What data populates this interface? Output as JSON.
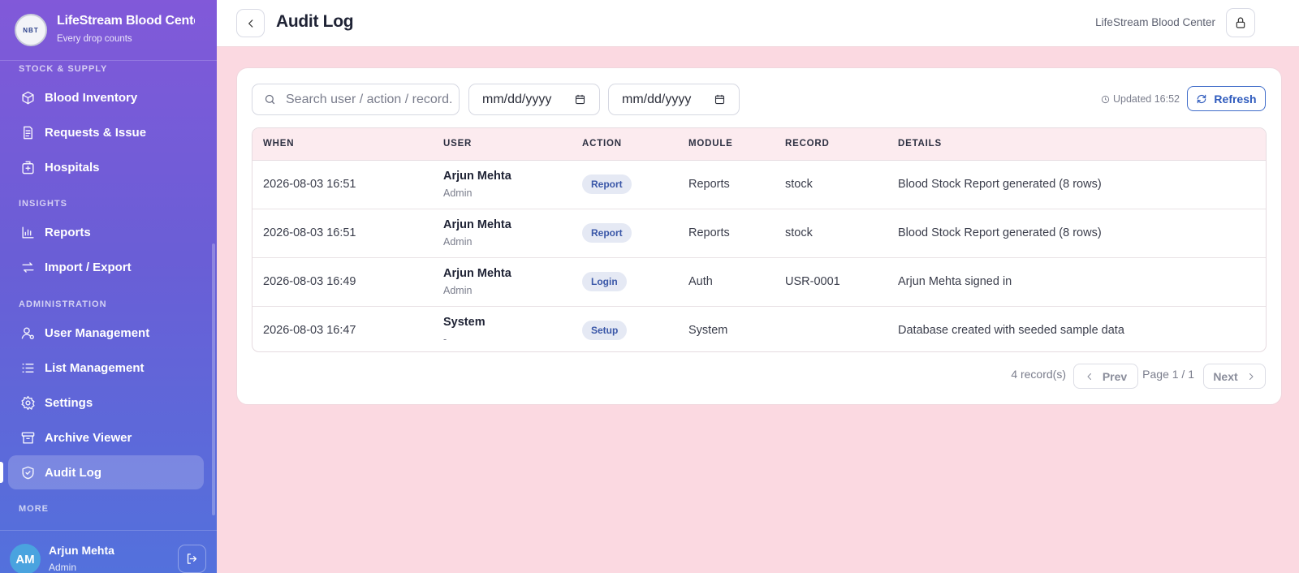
{
  "brand": {
    "logo_text": "NBT",
    "title": "LifeStream Blood Center",
    "subtitle": "Every drop counts"
  },
  "sidebar": {
    "sections": [
      {
        "label": "STOCK & SUPPLY"
      },
      {
        "label": "INSIGHTS"
      },
      {
        "label": "ADMINISTRATION"
      },
      {
        "label": "MORE"
      }
    ],
    "items": [
      {
        "label": "Blood Inventory",
        "icon": "box-icon"
      },
      {
        "label": "Requests & Issue",
        "icon": "document-icon"
      },
      {
        "label": "Hospitals",
        "icon": "hospital-icon"
      },
      {
        "label": "Reports",
        "icon": "bar-chart-icon"
      },
      {
        "label": "Import / Export",
        "icon": "transfer-icon"
      },
      {
        "label": "User Management",
        "icon": "user-cog-icon"
      },
      {
        "label": "List Management",
        "icon": "list-icon"
      },
      {
        "label": "Settings",
        "icon": "gear-icon"
      },
      {
        "label": "Archive Viewer",
        "icon": "archive-icon"
      },
      {
        "label": "Audit Log",
        "icon": "shield-check-icon",
        "active": true
      }
    ],
    "user": {
      "initials": "AM",
      "name": "Arjun Mehta",
      "role": "Admin"
    }
  },
  "header": {
    "title": "Audit Log",
    "org_name": "LifeStream Blood Center"
  },
  "filters": {
    "search_placeholder": "Search user / action / record...",
    "date_from": "mm/dd/yyyy",
    "date_to": "mm/dd/yyyy",
    "updated": "Updated 16:52",
    "refresh_label": "Refresh"
  },
  "table": {
    "columns": [
      "WHEN",
      "USER",
      "ACTION",
      "MODULE",
      "RECORD",
      "DETAILS"
    ],
    "rows": [
      {
        "when": "2026-08-03 16:51",
        "user": "Arjun Mehta",
        "role": "Admin",
        "action": "Report",
        "module": "Reports",
        "record": "stock",
        "details": "Blood Stock Report generated (8 rows)"
      },
      {
        "when": "2026-08-03 16:51",
        "user": "Arjun Mehta",
        "role": "Admin",
        "action": "Report",
        "module": "Reports",
        "record": "stock",
        "details": "Blood Stock Report generated (8 rows)"
      },
      {
        "when": "2026-08-03 16:49",
        "user": "Arjun Mehta",
        "role": "Admin",
        "action": "Login",
        "module": "Auth",
        "record": "USR-0001",
        "details": "Arjun Mehta signed in"
      },
      {
        "when": "2026-08-03 16:47",
        "user": "System",
        "role": "-",
        "action": "Setup",
        "module": "System",
        "record": "",
        "details": "Database created with seeded sample data"
      }
    ]
  },
  "pagination": {
    "count": "4 record(s)",
    "prev_label": "Prev",
    "page_info": "Page 1 / 1",
    "next_label": "Next"
  },
  "colors": {
    "sidebar_top": "#8159d9",
    "sidebar_bottom": "#5371dc",
    "page_bg": "#fbd9e1",
    "accent": "#2f5bbd",
    "action_pill": "#e5e9f4"
  }
}
